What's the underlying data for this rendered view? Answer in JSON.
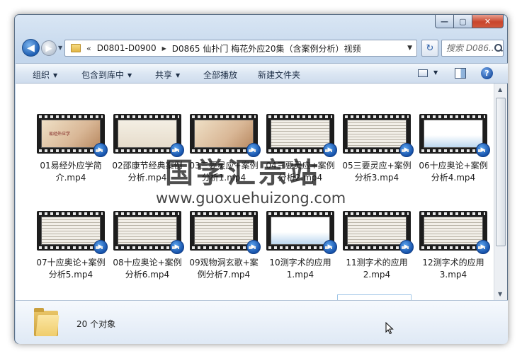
{
  "window": {
    "caption": {
      "minimize": "—",
      "maximize": "▢",
      "close": "✕"
    }
  },
  "nav": {
    "back_glyph": "◀",
    "forward_glyph": "▶",
    "history_glyph": "▼",
    "address": {
      "overflow": "«",
      "segments": [
        "D0801-D0900",
        "D0865 仙扑门 梅花外应20集（含案例分析）视频"
      ],
      "separator": "▶",
      "dropdown": "▼"
    },
    "refresh_glyph": "↻",
    "search_placeholder": "搜索 D086..."
  },
  "toolbar": {
    "organize": "组织",
    "include_in_library": "包含到库中",
    "share": "共享",
    "play_all": "全部播放",
    "new_folder": "新建文件夹",
    "caret": "▼",
    "help": "?"
  },
  "files": [
    {
      "label": "01易经外应学简介.mp4",
      "style": "warm",
      "slide_title": "易经外应学"
    },
    {
      "label": "02邵康节经典案例分析.mp4",
      "style": "list",
      "slide_title": ""
    },
    {
      "label": "03三要灵应+案例分析1.mp4",
      "style": "warm",
      "slide_title": ""
    },
    {
      "label": "04三要灵应+案例分析2.mp4",
      "style": "doc",
      "slide_title": ""
    },
    {
      "label": "05三要灵应+案例分析3.mp4",
      "style": "doc",
      "slide_title": ""
    },
    {
      "label": "06十应奥论+案例分析4.mp4",
      "style": "blue",
      "slide_title": ""
    },
    {
      "label": "07十应奥论+案例分析5.mp4",
      "style": "doc",
      "slide_title": ""
    },
    {
      "label": "08十应奥论+案例分析6.mp4",
      "style": "doc",
      "slide_title": ""
    },
    {
      "label": "09观物洞玄歌+案例分析7.mp4",
      "style": "doc",
      "slide_title": ""
    },
    {
      "label": "10测字术的应用1.mp4",
      "style": "blue",
      "slide_title": ""
    },
    {
      "label": "11测字术的应用2.mp4",
      "style": "doc",
      "slide_title": ""
    },
    {
      "label": "12测字术的应用3.mp4",
      "style": "doc",
      "slide_title": ""
    }
  ],
  "media_badge_glyph": "▶",
  "watermark": {
    "cn": "国学汇宗站",
    "url": "www.guoxuehuizong.com"
  },
  "details": {
    "item_count": "20 个对象"
  },
  "scrollbar": {
    "up": "▲",
    "down": "▼"
  }
}
